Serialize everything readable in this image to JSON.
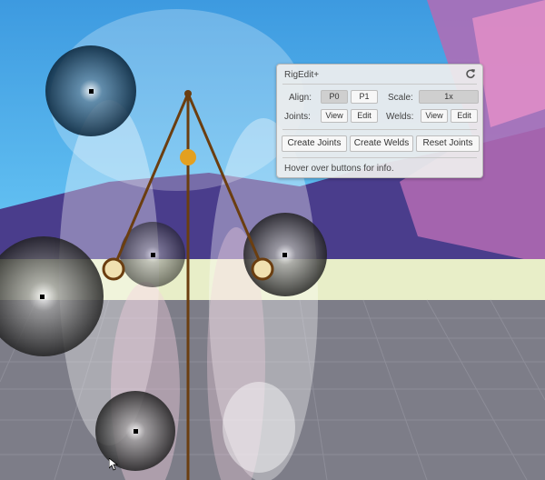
{
  "panel": {
    "title": "RigEdit+",
    "align_label": "Align:",
    "align_p0": "P0",
    "align_p1": "P1",
    "scale_label": "Scale:",
    "scale_value": "1x",
    "joints_label": "Joints:",
    "joints_view": "View",
    "joints_edit": "Edit",
    "welds_label": "Welds:",
    "welds_view": "View",
    "welds_edit": "Edit",
    "create_joints": "Create Joints",
    "create_welds": "Create Welds",
    "reset_joints": "Reset Joints",
    "status": "Hover over buttons for info."
  },
  "colors": {
    "bone": "#6b3e10",
    "joint_handle": "#f0e0b0",
    "center_handle": "#e3a020",
    "sky": "#4aa8e8",
    "floor": "#7d7d88"
  },
  "icons": {
    "refresh": "refresh-icon",
    "cursor": "mouse-pointer-icon"
  }
}
